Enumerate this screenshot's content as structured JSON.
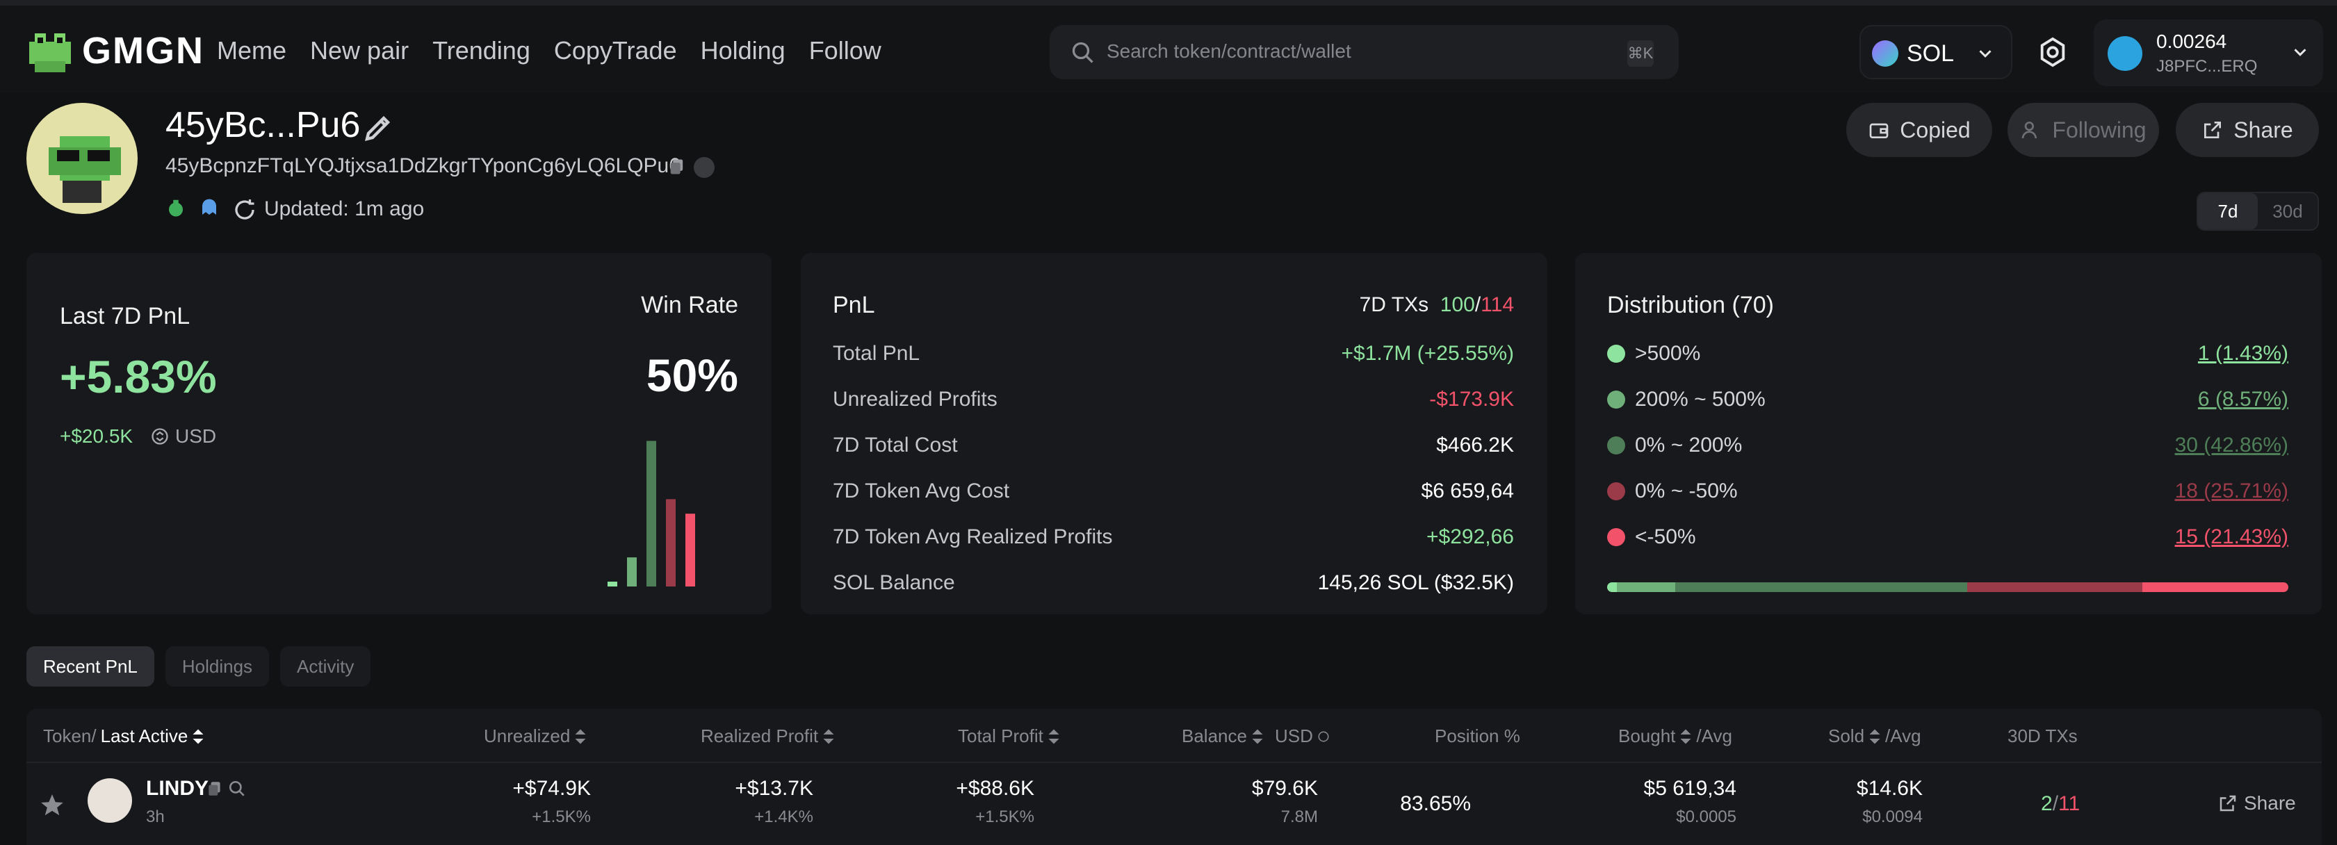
{
  "brand": "GMGN",
  "nav": [
    "Meme",
    "New pair",
    "Trending",
    "CopyTrade",
    "Holding",
    "Follow"
  ],
  "search": {
    "placeholder": "Search token/contract/wallet",
    "shortcut": "⌘K"
  },
  "chain": {
    "label": "SOL"
  },
  "wallet": {
    "balance": "0.00264",
    "address": "J8PFC...ERQ"
  },
  "profile": {
    "title": "45yBc...Pu6",
    "address": "45yBcpnzFTqLYQJtjxsa1DdZkgrTYponCg6yLQ6LQPu6",
    "updated": "Updated: 1m ago"
  },
  "actions": {
    "copied": "Copied",
    "following": "Following",
    "share": "Share"
  },
  "range": [
    "7d",
    "30d"
  ],
  "pnl_card": {
    "label": "Last 7D PnL",
    "value": "+5.83%",
    "sub": "+$20.5K",
    "currency": "USD",
    "winrate_label": "Win Rate",
    "winrate_value": "50%"
  },
  "stats": {
    "title": "PnL",
    "txs_label": "7D TXs",
    "txs_win": "100",
    "txs_sep": "/",
    "txs_total": "114",
    "rows": [
      {
        "k": "Total PnL",
        "v": "+$1.7M (+25.55%)",
        "color": "#8ee39e"
      },
      {
        "k": "Unrealized Profits",
        "v": "-$173.9K",
        "color": "#f2536a"
      },
      {
        "k": "7D Total Cost",
        "v": "$466.2K",
        "color": "#ffffff"
      },
      {
        "k": "7D Token Avg Cost",
        "v": "$6 659,64",
        "color": "#ffffff"
      },
      {
        "k": "7D Token Avg Realized Profits",
        "v": "+$292,66",
        "color": "#8ee39e"
      },
      {
        "k": "SOL Balance",
        "v": "145,26 SOL ($32.5K)",
        "color": "#ffffff"
      }
    ]
  },
  "distribution": {
    "title": "Distribution (70)",
    "rows": [
      {
        "k": ">500%",
        "v": "1 (1.43%)",
        "color": "#8ee39e"
      },
      {
        "k": "200% ~ 500%",
        "v": "6 (8.57%)",
        "color": "#6fb07a"
      },
      {
        "k": "0% ~ 200%",
        "v": "30 (42.86%)",
        "color": "#4e7e57"
      },
      {
        "k": "0% ~ -50%",
        "v": "18 (25.71%)",
        "color": "#9b3a48"
      },
      {
        "k": "<-50%",
        "v": "15 (21.43%)",
        "color": "#f2536a"
      }
    ],
    "shares": [
      1.43,
      8.57,
      42.86,
      25.71,
      21.43
    ]
  },
  "chart_data": {
    "type": "bar",
    "categories": [
      ">500%",
      "200% ~ 500%",
      "0% ~ 200%",
      "0% ~ -50%",
      "<-50%"
    ],
    "values": [
      1.43,
      8.57,
      42.86,
      25.71,
      21.43
    ],
    "title": "",
    "xlabel": "",
    "ylabel": "",
    "ylim": [
      0,
      45
    ]
  },
  "tabs": [
    "Recent PnL",
    "Holdings",
    "Activity"
  ],
  "table": {
    "headers": {
      "token": "Token/",
      "last_active": "Last Active",
      "unrealized": "Unrealized",
      "realized": "Realized Profit",
      "total": "Total Profit",
      "balance": "Balance",
      "usd": "USD",
      "position": "Position %",
      "bought": "Bought",
      "bought_avg": "/Avg",
      "sold": "Sold",
      "sold_avg": "/Avg",
      "txs": "30D TXs"
    },
    "row": {
      "token": "LINDY",
      "age": "3h",
      "unrealized": "+$74.9K",
      "unrealized_pct": "+1.5K%",
      "realized": "+$13.7K",
      "realized_pct": "+1.4K%",
      "total": "+$88.6K",
      "total_pct": "+1.5K%",
      "balance": "$79.6K",
      "balance_sub": "7.8M",
      "position": "83.65%",
      "bought": "$5 619,34",
      "bought_avg": "$0.0005",
      "sold": "$14.6K",
      "sold_avg": "$0.0094",
      "txs_buy": "2",
      "txs_sep": "/",
      "txs_sell": "11",
      "share": "Share"
    }
  }
}
